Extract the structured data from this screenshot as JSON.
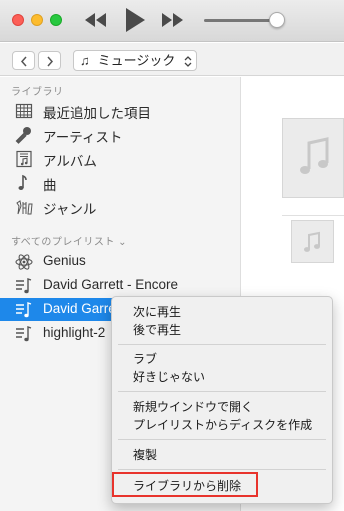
{
  "toolbar": {
    "icons": [
      "rewind-icon",
      "play-icon",
      "fast-forward-icon"
    ],
    "volume_level": 0.9
  },
  "navbar": {
    "media_kind": "ミュージック"
  },
  "sidebar": {
    "library_header": "ライブラリ",
    "library_items": [
      {
        "label": "最近追加した項目",
        "icon": "recently-added-icon"
      },
      {
        "label": "アーティスト",
        "icon": "microphone-icon"
      },
      {
        "label": "アルバム",
        "icon": "album-icon"
      },
      {
        "label": "曲",
        "icon": "music-note-icon"
      },
      {
        "label": "ジャンル",
        "icon": "genre-icon"
      }
    ],
    "playlists_header": "すべてのプレイリスト ⌄",
    "playlist_items": [
      {
        "label": "Genius",
        "icon": "genius-atom-icon"
      },
      {
        "label": "David Garrett - Encore",
        "icon": "playlist-icon"
      },
      {
        "label": "David Garrett",
        "icon": "playlist-icon",
        "selected": true
      },
      {
        "label": "highlight-2",
        "icon": "playlist-icon"
      }
    ]
  },
  "context_menu": {
    "groups": [
      [
        "次に再生",
        "後で再生"
      ],
      [
        "ラブ",
        "好きじゃない"
      ],
      [
        "新規ウインドウで開く",
        "プレイリストからディスクを作成"
      ],
      [
        "複製"
      ],
      [
        "ライブラリから削除"
      ]
    ],
    "highlighted_item": "ライブラリから削除",
    "highlight_color": "#e8332c"
  },
  "colors": {
    "selection": "#1e88ea",
    "sidebar_bg": "#f4f4f4"
  }
}
